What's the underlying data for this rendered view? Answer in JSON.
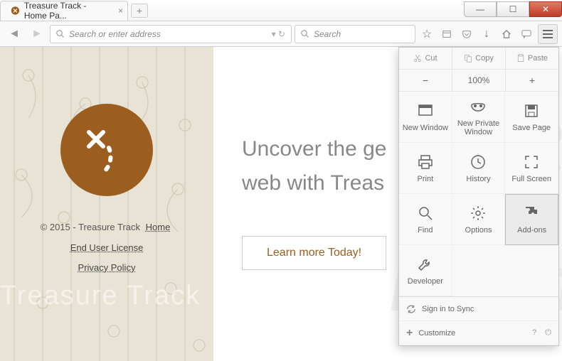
{
  "window": {
    "tab_title": "Treasure Track - Home Pa...",
    "min": "—",
    "max": "☐",
    "close": "✕",
    "newtab": "+"
  },
  "toolbar": {
    "url_placeholder": "Search or enter address",
    "search_placeholder": "Search"
  },
  "page": {
    "copyright": "© 2015 - Treasure Track",
    "link_home": "Home",
    "link_eula": "End User License",
    "link_privacy": "Privacy Policy",
    "headline1": "Uncover the ge",
    "headline2": "web with Treas",
    "cta": "Learn more Today!",
    "wm_text": "Treasure Track"
  },
  "menu": {
    "cut": "Cut",
    "copy": "Copy",
    "paste": "Paste",
    "zoom_out": "−",
    "zoom_val": "100%",
    "zoom_in": "+",
    "items": [
      "New Window",
      "New Private Window",
      "Save Page",
      "Print",
      "History",
      "Full Screen",
      "Find",
      "Options",
      "Add-ons",
      "Developer",
      "",
      ""
    ],
    "sign_in": "Sign in to Sync",
    "customize": "Customize"
  }
}
